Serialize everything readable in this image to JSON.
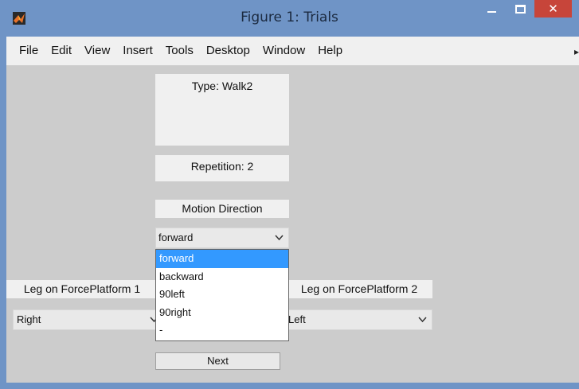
{
  "window": {
    "title": "Figure 1: Trials",
    "close_label": "✕"
  },
  "menu": {
    "items": [
      "File",
      "Edit",
      "View",
      "Insert",
      "Tools",
      "Desktop",
      "Window",
      "Help"
    ],
    "overflow_arrow": "▸"
  },
  "trial": {
    "type_text": "Type: Walk2",
    "repetition_text": "Repetition: 2"
  },
  "motion_direction": {
    "label": "Motion Direction",
    "selected": "forward",
    "options": [
      "forward",
      "backward",
      "90left",
      "90right",
      "-"
    ],
    "highlighted_index": 0
  },
  "force_platform_1": {
    "label": "Leg on ForcePlatform 1",
    "selected": "Right"
  },
  "force_platform_2": {
    "label": "Leg on ForcePlatform 2",
    "selected": "Left"
  },
  "next_button_label": "Next",
  "icons": {
    "app": "matlab-logo-icon",
    "chevron": "chevron-down-icon"
  },
  "colors": {
    "title_bar": "#6f94c6",
    "close_button": "#c7453a",
    "canvas": "#cccccc",
    "panel": "#f0f0f0",
    "selection": "#3399ff"
  }
}
